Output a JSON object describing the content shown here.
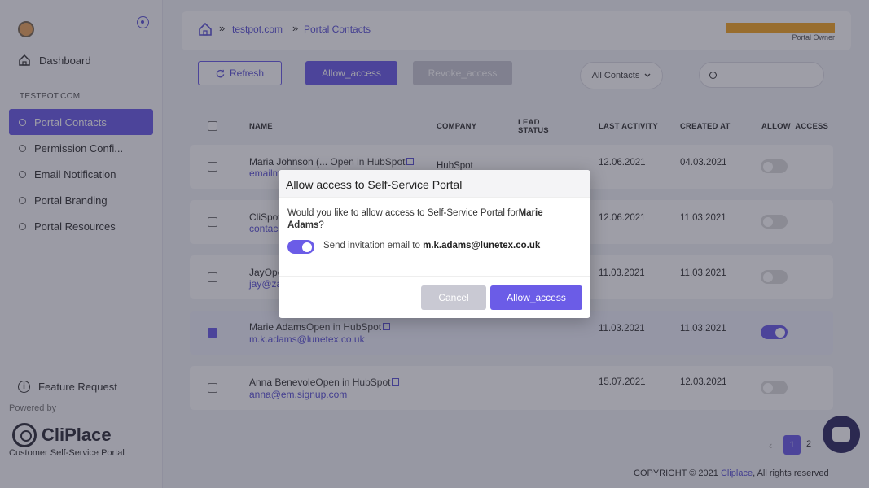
{
  "sidebar": {
    "dashboard_label": "Dashboard",
    "section_label": "TESTPOT.COM",
    "items": [
      {
        "label": "Portal Contacts"
      },
      {
        "label": "Permission Confi..."
      },
      {
        "label": "Email Notification"
      },
      {
        "label": "Portal Branding"
      },
      {
        "label": "Portal Resources"
      }
    ],
    "feature_request": "Feature Request",
    "powered_by": "Powered by",
    "brand": "CliPlace",
    "tagline": "Customer Self-Service Portal"
  },
  "topbar": {
    "crumb1": "testpot.com",
    "crumb2": "Portal Contacts",
    "sep": "»",
    "owner_label": "Portal Owner",
    "owner_color": "#f5a623"
  },
  "toolbar": {
    "refresh": "Refresh",
    "allow": "Allow_access",
    "revoke": "Revoke_access",
    "filter": "All Contacts",
    "search_placeholder": ""
  },
  "table": {
    "headers": {
      "name": "NAME",
      "company": "COMPANY",
      "lead1": "LEAD",
      "lead2": "STATUS",
      "last_activity": "LAST ACTIVITY",
      "created_at": "CREATED AT",
      "allow_access": "ALLOW_ACCESS"
    },
    "rows": [
      {
        "name": "Maria Johnson (...",
        "hs": "Open in HubSpot",
        "email": "emailm",
        "company": "HubSpot",
        "last": "12.06.2021",
        "created": "04.03.2021",
        "on": false
      },
      {
        "name": "CliSpot",
        "hs": "",
        "email": "contac",
        "company": "",
        "last": "12.06.2021",
        "created": "11.03.2021",
        "on": false
      },
      {
        "name": "Jay",
        "hs": "Ope",
        "email": "jay@za",
        "company": "",
        "last": "11.03.2021",
        "created": "11.03.2021",
        "on": false
      },
      {
        "name": "Marie Adams",
        "hs": "Open in HubSpot",
        "email": "m.k.adams@lunetex.co.uk",
        "company": "",
        "last": "11.03.2021",
        "created": "11.03.2021",
        "on": true
      },
      {
        "name": "Anna Benevole",
        "hs": "Open in HubSpot",
        "email": "anna@em.signup.com",
        "company": "",
        "last": "15.07.2021",
        "created": "12.03.2021",
        "on": false
      }
    ]
  },
  "pager": {
    "prev": "‹",
    "p1": "1",
    "p2": "2"
  },
  "footer": {
    "prefix": "COPYRIGHT © 2021 ",
    "link": "Cliplace",
    "suffix": ", All rights reserved"
  },
  "modal": {
    "title": "Allow access to Self-Service Portal",
    "text_prefix": "Would you like to allow access to Self-Service Portal for",
    "text_name": "Marie Adams",
    "text_suffix": "?",
    "invite_prefix": "Send invitation email to ",
    "invite_email": "m.k.adams@lunetex.co.uk",
    "cancel": "Cancel",
    "allow": "Allow_access"
  },
  "colors": {
    "accent": "#6b5ce7",
    "disabled": "#c9c9d3"
  }
}
